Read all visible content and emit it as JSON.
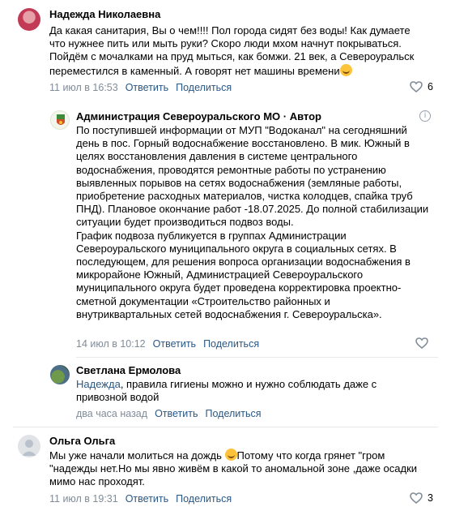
{
  "comments": [
    {
      "author": "Надежда Николаевна",
      "lines": [
        "Да какая санитария, Вы о чем!!!! Пол города сидят без воды! Как думаете",
        "что нужнее пить или мыть руки? Скоро люди мхом начнут покрываться.",
        "Пойдём с мочалками на пруд мыться, как бомжи. 21 век, а Североуральск",
        "переместился в каменный. А говорят нет машины времени"
      ],
      "emoji": "grinning-sweat-emoji",
      "date": "11 июл в 16:53",
      "reply_label": "Ответить",
      "share_label": "Поделиться",
      "likes": "6"
    },
    {
      "author": "Администрация Североуральского МО · Автор",
      "lines": [
        "По поступившей информации от МУП \"Водоканал\" на сегодняшний",
        "день в пос. Горный водоснабжение восстановлено. В мик. Южный в",
        "целях восстановления давления в системе центрального",
        "водоснабжения, проводятся ремонтные работы по устранению",
        "выявленных порывов на сетях водоснабжения (земляные работы,",
        "приобретение расходных материалов, чистка колодцев, спайка труб",
        "ПНД). Плановое окончание работ -18.07.2025. До полной стабилизации",
        "ситуации будет производиться подвоз воды.",
        "График подвоза публикуется в группах Администрации",
        "Североуральского муниципального округа в социальных сетях. В",
        "последующем, для решения вопроса организации водоснабжения в",
        "микрорайоне Южный, Администрацией Североуральского",
        "муниципального округа будет проведена корректировка проектно-",
        "сметной документации «Строительство районных и",
        "внутриквартальных сетей водоснабжения г. Североуральска»."
      ],
      "date": "14 июл в 10:12",
      "reply_label": "Ответить",
      "share_label": "Поделиться",
      "info_icon": "i"
    },
    {
      "author": "Светлана Ермолова",
      "mention": "Надежда",
      "lines": [
        ", правила гигиены можно и нужно соблюдать даже с",
        "привозной водой"
      ],
      "date": "два часа назад",
      "reply_label": "Ответить",
      "share_label": "Поделиться"
    },
    {
      "author": "Ольга Ольга",
      "lines": [
        "Мы уже начали молиться на дождь",
        "Потому что когда грянет \"гром",
        "\"надежды нет.Но мы явно живём в какой то аномальной зоне ,даже осадки",
        "мимо нас проходят."
      ],
      "emoji": "grinning-sweat-emoji",
      "date": "11 июл в 19:31",
      "reply_label": "Ответить",
      "share_label": "Поделиться",
      "likes": "3"
    }
  ],
  "colors": {
    "link": "#2a5885",
    "meta": "#818c99",
    "divider": "#e7e8ec"
  }
}
